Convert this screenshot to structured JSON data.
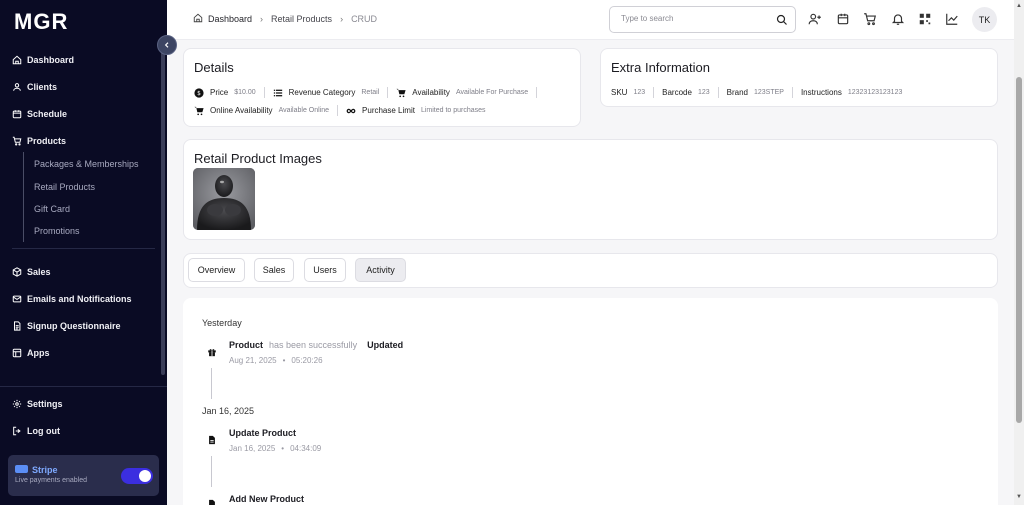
{
  "app": {
    "logo": "MGR"
  },
  "sidebar": {
    "items": [
      {
        "label": "Dashboard",
        "icon": "home-icon"
      },
      {
        "label": "Clients",
        "icon": "user-icon"
      },
      {
        "label": "Schedule",
        "icon": "calendar-icon"
      },
      {
        "label": "Products",
        "icon": "cart-icon"
      }
    ],
    "sub_items": [
      "Packages & Memberships",
      "Retail Products",
      "Gift Card",
      "Promotions"
    ],
    "items2": [
      {
        "label": "Sales",
        "icon": "box-icon"
      },
      {
        "label": "Emails and Notifications",
        "icon": "mail-icon"
      },
      {
        "label": "Signup Questionnaire",
        "icon": "document-icon"
      },
      {
        "label": "Apps",
        "icon": "apps-icon"
      }
    ],
    "bottom": [
      {
        "label": "Settings",
        "icon": "gear-icon"
      },
      {
        "label": "Log out",
        "icon": "logout-icon"
      }
    ],
    "stripe": {
      "name": "Stripe",
      "status": "Live payments enabled",
      "enabled": true
    }
  },
  "header": {
    "breadcrumbs": [
      "Dashboard",
      "Retail Products",
      "CRUD"
    ],
    "search_placeholder": "Type to search",
    "avatar": "TK"
  },
  "details": {
    "title": "Details",
    "price_label": "Price",
    "price_value": "$10.00",
    "category_label": "Revenue Category",
    "category_value": "Retail",
    "availability_label": "Availability",
    "availability_value": "Available For Purchase",
    "online_label": "Online Availability",
    "online_value": "Available Online",
    "limit_label": "Purchase Limit",
    "limit_value": "Limited to purchases"
  },
  "extra": {
    "title": "Extra Information",
    "sku_label": "SKU",
    "sku_value": "123",
    "barcode_label": "Barcode",
    "barcode_value": "123",
    "brand_label": "Brand",
    "brand_value": "123STEP",
    "instructions_label": "Instructions",
    "instructions_value": "12323123123123"
  },
  "images": {
    "title": "Retail Product Images"
  },
  "tabs": [
    "Overview",
    "Sales",
    "Users",
    "Activity"
  ],
  "active_tab": "Activity",
  "activity": {
    "groups": [
      {
        "date": "Yesterday",
        "entries": [
          {
            "title": "Product",
            "middle": "has been successfully",
            "action": "Updated",
            "date": "Aug 21, 2025",
            "time": "05:20:26",
            "icon": "gift-icon"
          }
        ]
      },
      {
        "date": "Jan 16, 2025",
        "entries": [
          {
            "title": "Update Product",
            "date": "Jan 16, 2025",
            "time": "04:34:09",
            "icon": "file-icon"
          },
          {
            "title": "Add New Product",
            "icon": "file-icon"
          }
        ]
      }
    ]
  },
  "colors": {
    "sidebar_bg": "#0a0b24",
    "accent": "#3b2ee0",
    "stripe_blue": "#7ea9ff"
  }
}
